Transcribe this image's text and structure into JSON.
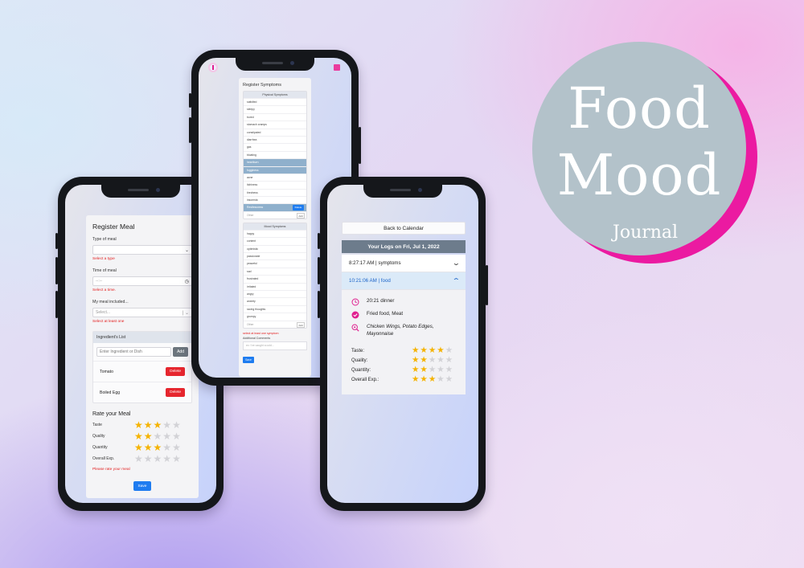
{
  "logo": {
    "line1": "Food",
    "line2": "Mood",
    "line3": "Journal",
    "accent_color": "#eb1aa1",
    "disc_color": "#b3c2ca"
  },
  "meal_form": {
    "title": "Register Meal",
    "type_label": "Type of meal",
    "type_error": "Select a type",
    "time_label": "Time of meal",
    "time_placeholder": "--:--",
    "time_error": "Select a time.",
    "included_label": "My meal included...",
    "included_placeholder": "Select...",
    "included_error": "Select at least one",
    "ingredients_title": "Ingredient's List",
    "ingredient_placeholder": "Enter Ingredient or Dish",
    "add_label": "Add",
    "ingredients": [
      {
        "name": "Tomato",
        "delete_label": "Delete"
      },
      {
        "name": "Boiled Egg",
        "delete_label": "Delete"
      }
    ],
    "rate_title": "Rate your Meal",
    "ratings": [
      {
        "label": "Taste",
        "stars": 3
      },
      {
        "label": "Quality",
        "stars": 2
      },
      {
        "label": "Quantity",
        "stars": 3
      },
      {
        "label": "Overall Exp.",
        "stars": 0
      }
    ],
    "rate_error": "Please rate your meal",
    "save_label": "Save"
  },
  "symptoms_form": {
    "title": "Register Symptoms",
    "physical_title": "Physical Symptoms",
    "physical_items": [
      {
        "label": "satisfied",
        "selected": false
      },
      {
        "label": "sleepy",
        "selected": false
      },
      {
        "label": "bored",
        "selected": false
      },
      {
        "label": "stomach cramps",
        "selected": false
      },
      {
        "label": "constipated",
        "selected": false
      },
      {
        "label": "diarrhea",
        "selected": false
      },
      {
        "label": "gas",
        "selected": false
      },
      {
        "label": "bloating",
        "selected": false
      },
      {
        "label": "heartburn",
        "selected": true
      },
      {
        "label": "fogginess",
        "selected": true
      },
      {
        "label": "acne",
        "selected": false
      },
      {
        "label": "itchiness",
        "selected": false
      },
      {
        "label": "tiredness",
        "selected": false
      },
      {
        "label": "insomnia",
        "selected": false
      },
      {
        "label": "Restlessness",
        "selected": true
      }
    ],
    "delete_label": "Delete",
    "other_placeholder": "Other",
    "add_label": "Add",
    "mood_title": "Mood Symptoms",
    "mood_items": [
      {
        "label": "happy"
      },
      {
        "label": "content"
      },
      {
        "label": "optimistic"
      },
      {
        "label": "passionate"
      },
      {
        "label": "peaceful"
      },
      {
        "label": "sad"
      },
      {
        "label": "frustrated"
      },
      {
        "label": "irritated"
      },
      {
        "label": "angry"
      },
      {
        "label": "anxiety"
      },
      {
        "label": "racing thoughts"
      },
      {
        "label": "grumpy"
      }
    ],
    "symptom_error": "select at least one symptom",
    "comments_label": "Additional Comments",
    "comments_placeholder": "ex: I've caught a cold...",
    "save_label": "Save"
  },
  "log_view": {
    "back_label": "Back to Calendar",
    "header": "Your Logs on Fri, Jul 1, 2022",
    "entries": [
      {
        "label": "8:27:17 AM | symptoms"
      },
      {
        "label": "10:21:06 AM | food"
      }
    ],
    "detail": {
      "time": "20:21 dinner",
      "type": "Fried food, Meat",
      "items": "Chicken Wings, Potato Edges, Mayonnaise",
      "ratings": [
        {
          "label": "Taste:",
          "stars": 4
        },
        {
          "label": "Quality:",
          "stars": 2
        },
        {
          "label": "Quantity:",
          "stars": 2
        },
        {
          "label": "Overall Exp.:",
          "stars": 3
        }
      ],
      "icon_color": "#e0208f",
      "star_color": "#f5b301"
    }
  }
}
